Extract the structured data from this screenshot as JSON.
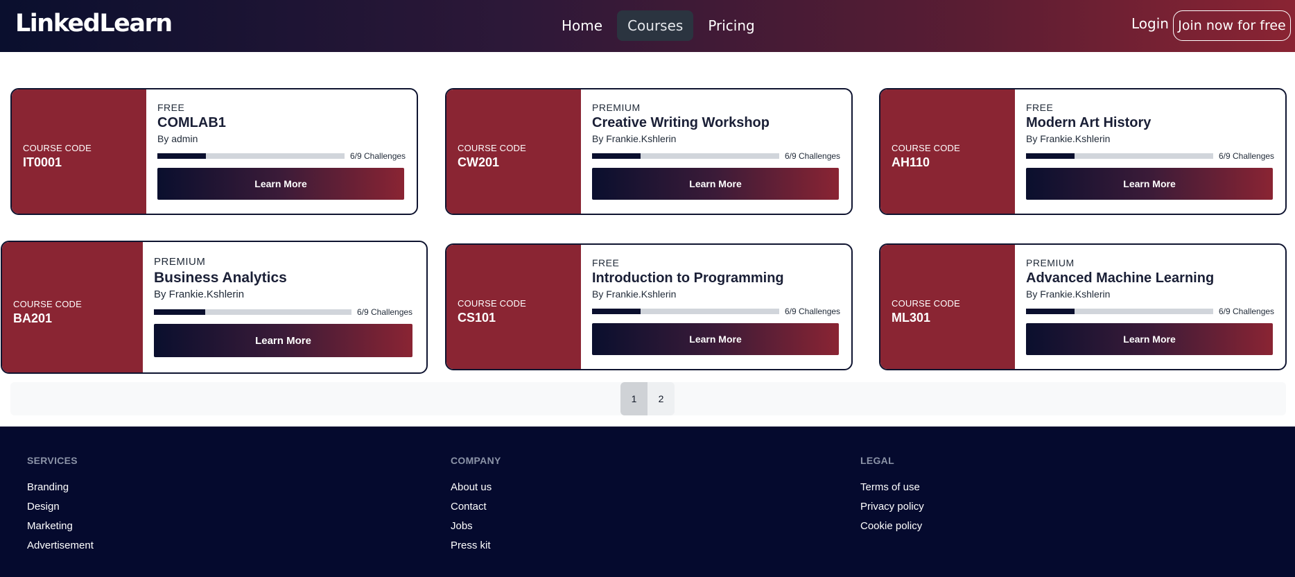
{
  "navbar": {
    "logo": "LinkedLearn",
    "links": [
      {
        "label": "Home"
      },
      {
        "label": "Courses"
      },
      {
        "label": "Pricing"
      }
    ],
    "login": "Login",
    "join": "Join now for free"
  },
  "courses": [
    {
      "code_label": "COURSE CODE",
      "code": "IT0001",
      "tier": "FREE",
      "title": "COMLAB1",
      "author": "By admin",
      "progress": 0.26,
      "progress_text": "6/9 Challenges",
      "button": "Learn More"
    },
    {
      "code_label": "COURSE CODE",
      "code": "CW201",
      "tier": "PREMIUM",
      "title": "Creative Writing Workshop",
      "author": "By Frankie.Kshlerin",
      "progress": 0.26,
      "progress_text": "6/9 Challenges",
      "button": "Learn More"
    },
    {
      "code_label": "COURSE CODE",
      "code": "AH110",
      "tier": "FREE",
      "title": "Modern Art History",
      "author": "By Frankie.Kshlerin",
      "progress": 0.26,
      "progress_text": "6/9 Challenges",
      "button": "Learn More"
    },
    {
      "code_label": "COURSE CODE",
      "code": "BA201",
      "tier": "PREMIUM",
      "title": "Business Analytics",
      "author": "By Frankie.Kshlerin",
      "progress": 0.26,
      "progress_text": "6/9 Challenges",
      "button": "Learn More"
    },
    {
      "code_label": "COURSE CODE",
      "code": "CS101",
      "tier": "FREE",
      "title": "Introduction to Programming",
      "author": "By Frankie.Kshlerin",
      "progress": 0.26,
      "progress_text": "6/9 Challenges",
      "button": "Learn More"
    },
    {
      "code_label": "COURSE CODE",
      "code": "ML301",
      "tier": "PREMIUM",
      "title": "Advanced Machine Learning",
      "author": "By Frankie.Kshlerin",
      "progress": 0.26,
      "progress_text": "6/9 Challenges",
      "button": "Learn More"
    }
  ],
  "pagination": {
    "pages": [
      "1",
      "2"
    ],
    "current": "1"
  },
  "footer": {
    "services": {
      "heading": "SERVICES",
      "items": [
        "Branding",
        "Design",
        "Marketing",
        "Advertisement"
      ]
    },
    "company": {
      "heading": "COMPANY",
      "items": [
        "About us",
        "Contact",
        "Jobs",
        "Press kit"
      ]
    },
    "legal": {
      "heading": "LEGAL",
      "items": [
        "Terms of use",
        "Privacy policy",
        "Cookie policy"
      ]
    }
  },
  "colors": {
    "brand_dark": "#0a0f2e",
    "brand_red": "#8a2533",
    "footer_bg": "#050a2e"
  }
}
